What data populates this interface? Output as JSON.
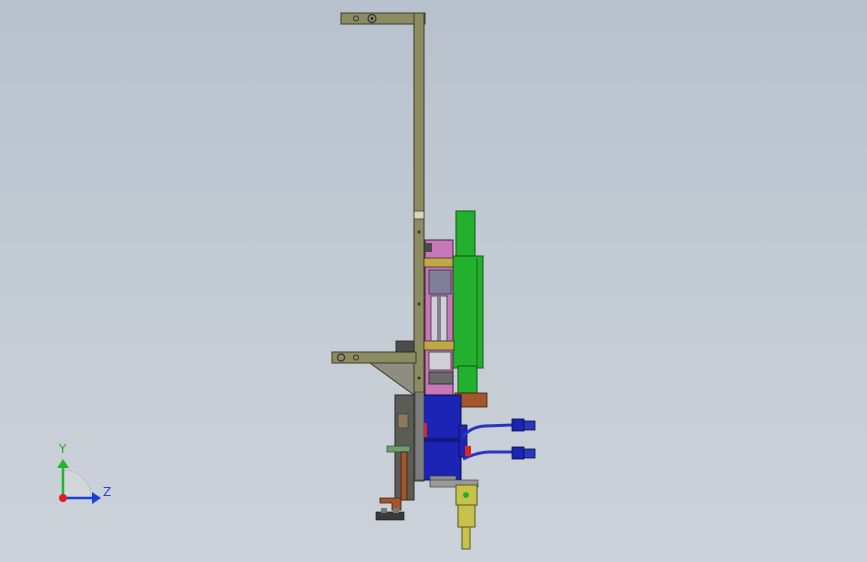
{
  "viewport": {
    "background_top": "#b7c1cd",
    "background_bottom": "#ccd2d9"
  },
  "triad": {
    "y_label": "Y",
    "z_label": "Z",
    "colors": {
      "y": "#27b233",
      "z": "#1a3fd6",
      "x": "#e01e1e"
    }
  },
  "part_colors": {
    "frame": "#8c8c63",
    "cylinder": "#22b02e",
    "motor": "#1c24b5",
    "bracket": "#a3552c",
    "nozzle": "#c9c24a",
    "fitting": "#2b36c0",
    "pink_plate": "#c877b8"
  }
}
